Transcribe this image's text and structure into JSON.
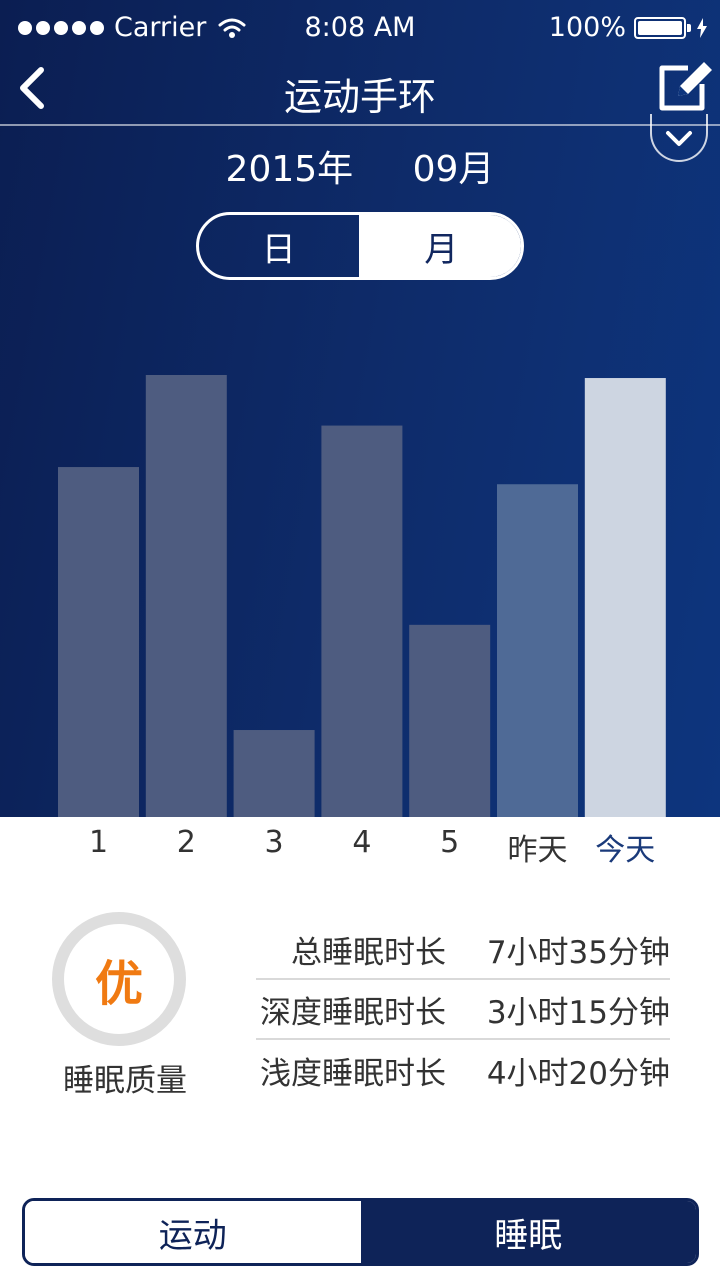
{
  "status_bar": {
    "carrier": "Carrier",
    "time": "8:08 AM",
    "battery": "100%"
  },
  "nav": {
    "title": "运动手环",
    "back_icon": "chevron-left-icon",
    "edit_icon": "edit-icon",
    "dropdown_icon": "chevron-down-icon"
  },
  "date": {
    "year": "2015年",
    "month": "09月"
  },
  "period_toggle": {
    "day": "日",
    "month": "月",
    "selected": "月"
  },
  "chart_data": {
    "type": "bar",
    "categories": [
      "1",
      "2",
      "3",
      "4",
      "5",
      "昨天",
      "今天"
    ],
    "values": [
      346,
      437,
      86,
      387,
      190,
      329,
      434
    ],
    "highlighted": "今天",
    "colors": {
      "bar": "#4e5c80",
      "bar_recent": "#4f6a96",
      "bar_today": "#cdd5e1",
      "label_today": "#1a3a7a"
    }
  },
  "sleep": {
    "quality_grade": "优",
    "quality_label": "睡眠质量",
    "stats": [
      {
        "label": "总睡眠时长",
        "value": "7小时35分钟"
      },
      {
        "label": "深度睡眠时长",
        "value": "3小时15分钟"
      },
      {
        "label": "浅度睡眠时长",
        "value": "4小时20分钟"
      }
    ]
  },
  "tabs": {
    "sport": "运动",
    "sleep": "睡眠",
    "selected": "睡眠"
  }
}
